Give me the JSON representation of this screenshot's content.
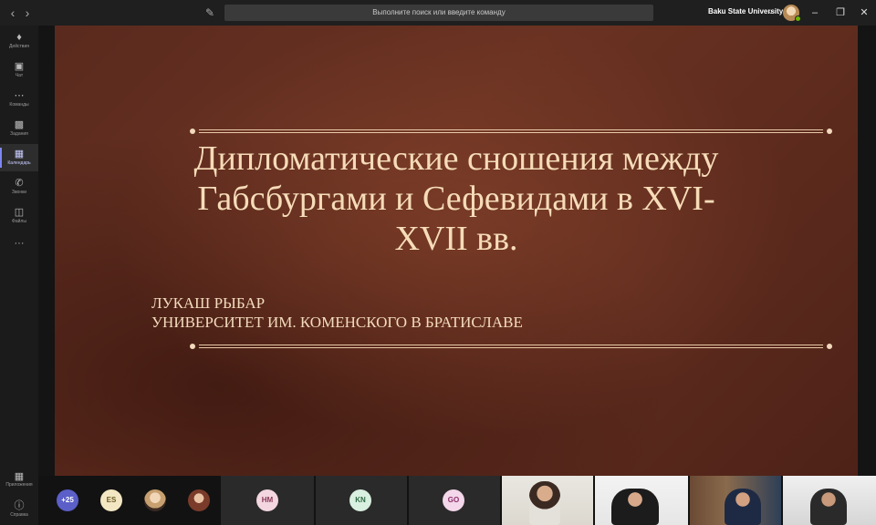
{
  "search": {
    "placeholder": "Выполните поиск или введите команду"
  },
  "header": {
    "org": "Baku State University"
  },
  "rail": {
    "items": [
      {
        "label": "Действия",
        "icon": "bell-icon"
      },
      {
        "label": "Чат",
        "icon": "chat-icon"
      },
      {
        "label": "Команды",
        "icon": "teams-icon"
      },
      {
        "label": "Задания",
        "icon": "assignments-icon"
      },
      {
        "label": "Календарь",
        "icon": "calendar-icon"
      },
      {
        "label": "Звонки",
        "icon": "phone-icon"
      },
      {
        "label": "Файлы",
        "icon": "files-icon"
      }
    ],
    "more": "···",
    "apps": "Приложения",
    "help": "Справка"
  },
  "slide": {
    "title_line1": "Дипломатические сношения между",
    "title_line2": "Габсбургами и Сефевидами в XVI-",
    "title_line3": "XVII вв.",
    "author": "ЛУКАШ РЫБАР",
    "affiliation": "УНИВЕРСИТЕТ ИМ. КОМЕНСКОГО В БРАТИСЛАВЕ"
  },
  "participants": {
    "overflow": "+25",
    "es": "ES",
    "hm": "HM",
    "kn": "KN",
    "go": "GO"
  },
  "colors": {
    "accent": "#7f85f5",
    "slide_bg": "#5a2a1e",
    "slide_text": "#f6dcb8",
    "presence": "#6bb700"
  }
}
